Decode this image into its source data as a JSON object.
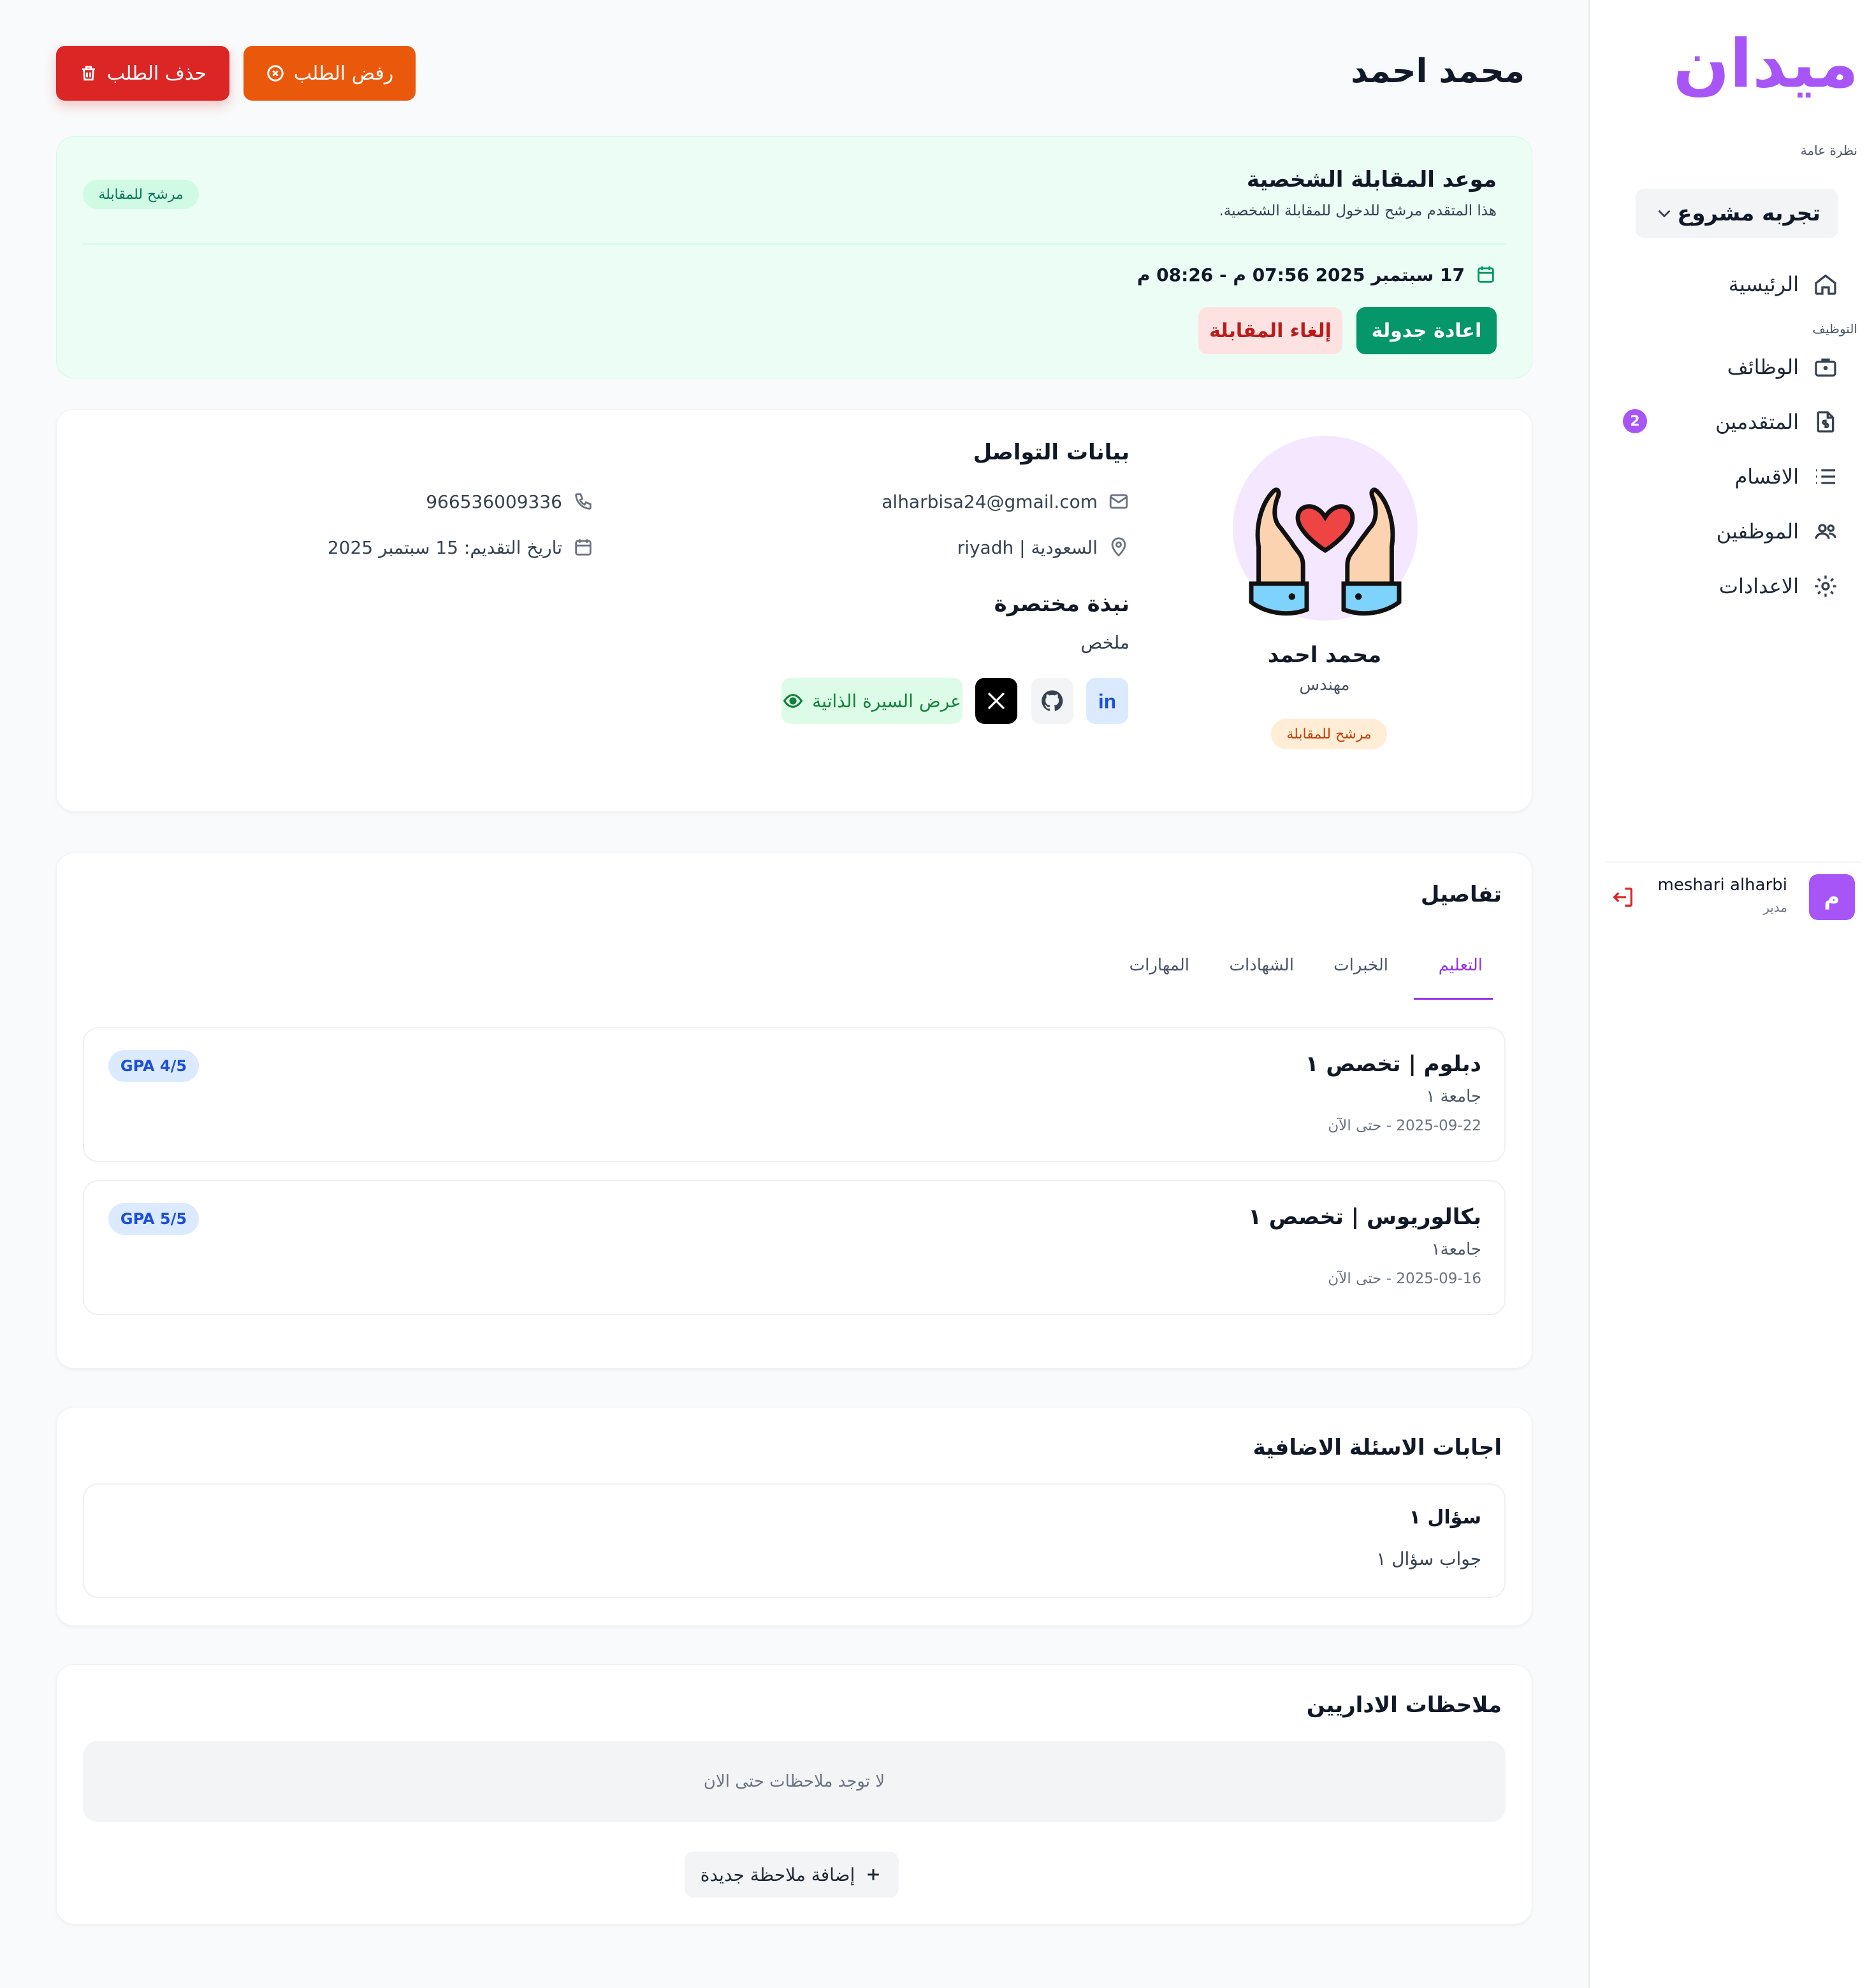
{
  "sidebar": {
    "logo": "ميدان",
    "overview_label": "نظرة عامة",
    "project": "تجربه مشروع",
    "recruit_label": "التوظيف",
    "items": [
      {
        "label": "الرئيسية",
        "icon": "home-icon"
      },
      {
        "label": "الوظائف",
        "icon": "briefcase-icon"
      },
      {
        "label": "المتقدمين",
        "icon": "document-dollar-icon",
        "badge": "2"
      },
      {
        "label": "الاقسام",
        "icon": "list-icon"
      },
      {
        "label": "الموظفين",
        "icon": "users-icon"
      },
      {
        "label": "الاعدادات",
        "icon": "gear-icon"
      }
    ],
    "user": {
      "initial": "م",
      "name": "meshari alharbi",
      "role": "مدير"
    }
  },
  "header": {
    "title": "محمد احمد",
    "reject_label": "رفض الطلب",
    "delete_label": "حذف الطلب"
  },
  "interview": {
    "title": "موعد المقابلة الشخصية",
    "subtitle": "هذا المتقدم مرشح للدخول للمقابلة الشخصية.",
    "status": "مرشح للمقابلة",
    "datetime": "17 سبتمبر 2025 07:56 م - 08:26 م",
    "reschedule_label": "اعادة جدولة",
    "cancel_label": "إلغاء المقابلة"
  },
  "profile": {
    "name": "محمد احمد",
    "role": "مهندس",
    "status": "مرشح للمقابلة",
    "contact_title": "بيانات التواصل",
    "email": "alharbisa24@gmail.com",
    "phone": "966536009336",
    "location": "السعودية | riyadh",
    "applied": "تاريخ التقديم: 15 سبتمبر 2025",
    "bio_title": "نبذة مختصرة",
    "bio": "ملخص",
    "cv_label": "عرض السيرة الذاتية"
  },
  "details": {
    "title": "تفاصيل",
    "tabs": [
      "التعليم",
      "الخبرات",
      "الشهادات",
      "المهارات"
    ],
    "education": [
      {
        "title": "دبلوم | تخصص ١",
        "school": "جامعة ١",
        "dates": "2025-09-22 - حتى الآن",
        "gpa": "GPA 4/5"
      },
      {
        "title": "بكالوريوس | تخصص ١",
        "school": "جامعة١",
        "dates": "2025-09-16 - حتى الآن",
        "gpa": "GPA 5/5"
      }
    ]
  },
  "questions": {
    "title": "اجابات الاسئلة الاضافية",
    "items": [
      {
        "q": "سؤال ١",
        "a": "جواب سؤال ١"
      }
    ]
  },
  "notes": {
    "title": "ملاحظات الاداريين",
    "empty": "لا توجد ملاحظات حتى الان",
    "add_label": "إضافة ملاحظة جديدة"
  },
  "colors": {
    "accent": "#a855f7",
    "green": "#059669",
    "red": "#dc2626",
    "orange": "#ea580c"
  }
}
